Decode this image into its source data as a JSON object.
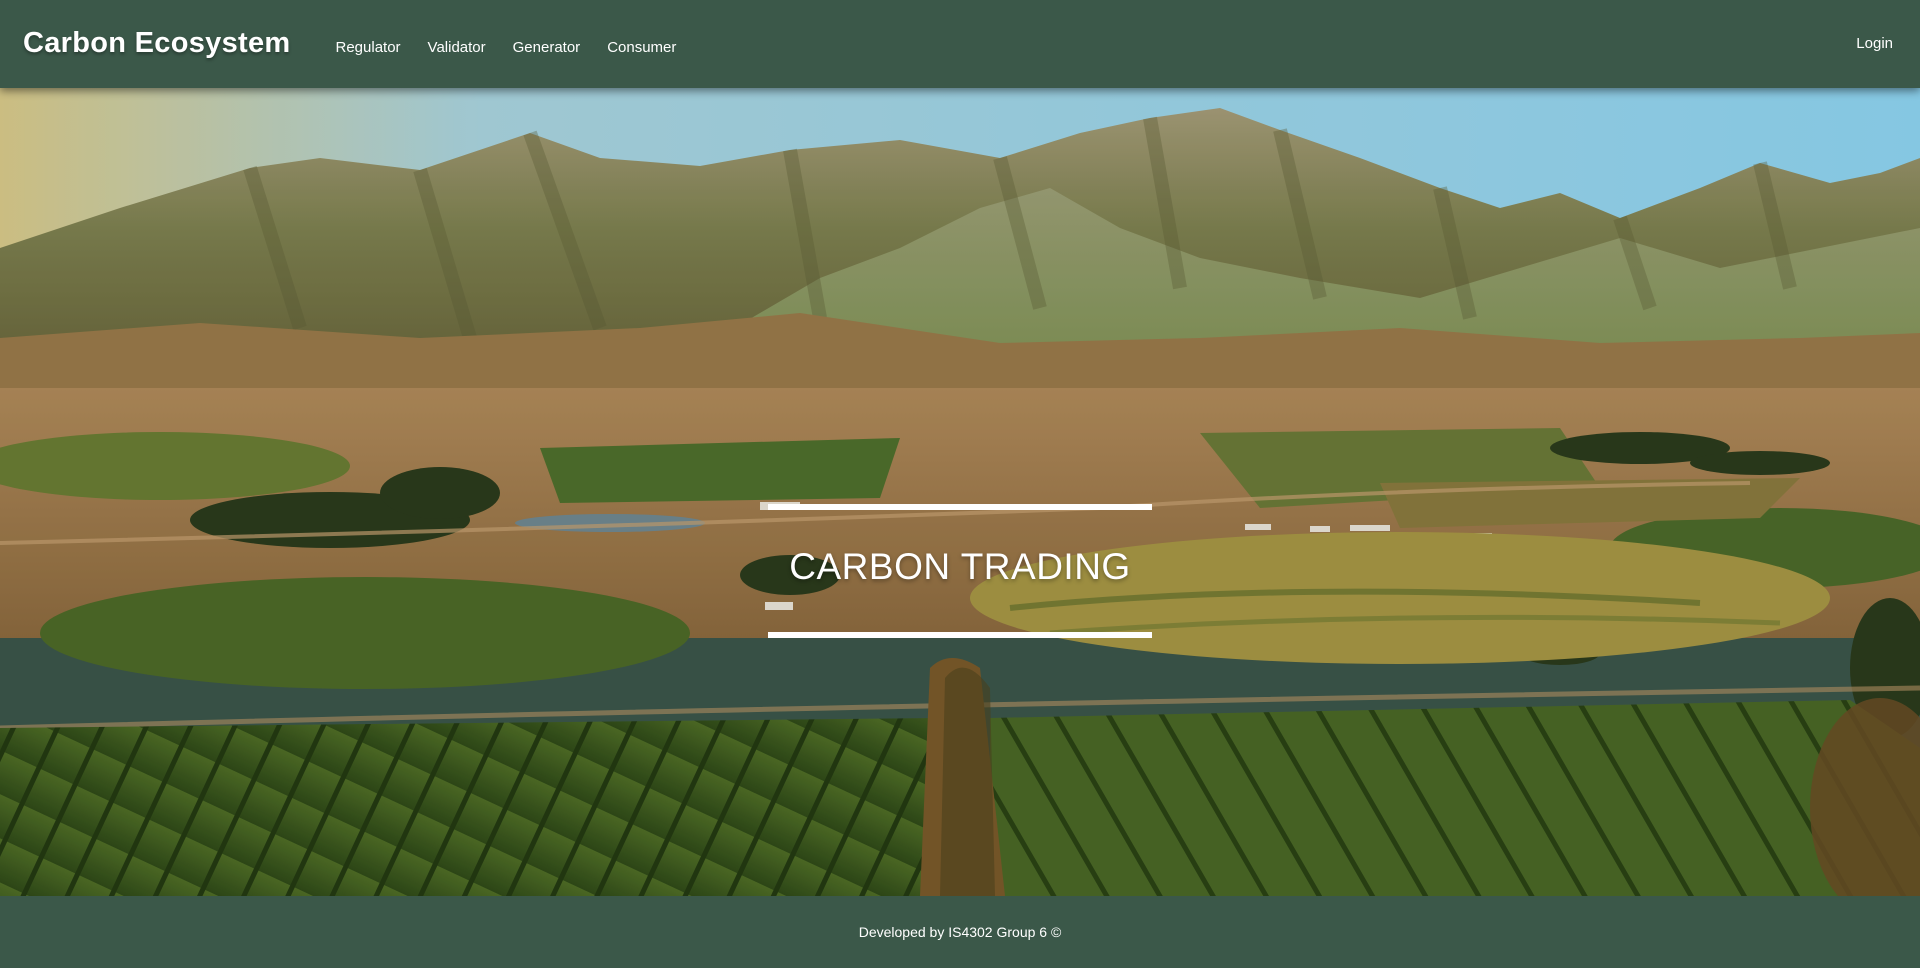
{
  "navbar": {
    "brand": "Carbon Ecosystem",
    "links": [
      "Regulator",
      "Validator",
      "Generator",
      "Consumer"
    ],
    "login": "Login"
  },
  "hero": {
    "title": "CARBON TRADING",
    "background": "mountain-farmland-landscape"
  },
  "footer": {
    "text": "Developed by IS4302 Group 6 ©"
  },
  "colors": {
    "nav_bg": "#3b5849",
    "text": "#ffffff",
    "sky": "#8ed2ee",
    "mountain": "#8a8a5a",
    "field_green": "#4e6e2a",
    "field_gold": "#a99945"
  }
}
